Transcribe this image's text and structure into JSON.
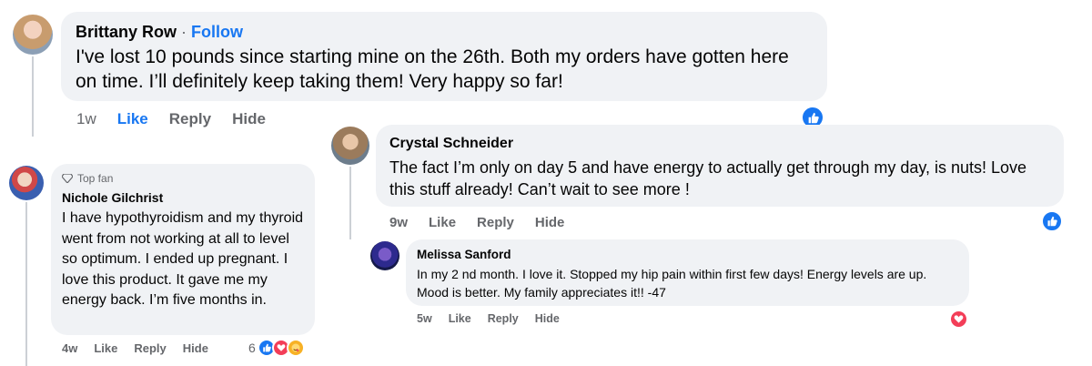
{
  "comments": {
    "brittany": {
      "name": "Brittany Row",
      "separator": "·",
      "follow_label": "Follow",
      "text": "I've lost 10 pounds since starting mine on the 26th. Both my orders have gotten here on time. I’ll definitely keep taking them! Very happy so far!",
      "time": "1w",
      "like": "Like",
      "reply": "Reply",
      "hide": "Hide",
      "reaction_icon": "like-icon"
    },
    "crystal": {
      "name": "Crystal Schneider",
      "text": "The fact I’m only on day 5 and have energy to actually get through my day, is nuts! Love this stuff already! Can’t wait to see more !",
      "time": "9w",
      "like": "Like",
      "reply": "Reply",
      "hide": "Hide",
      "reaction_icon": "like-icon"
    },
    "nichole": {
      "badge": "Top fan",
      "name": "Nichole Gilchrist",
      "text": "I have hypothyroidism and my thyroid went from not working at all to level so optimum. I ended up pregnant. I love this product. It gave me my energy back. I’m five months in.",
      "time": "4w",
      "like": "Like",
      "reply": "Reply",
      "hide": "Hide",
      "reaction_count": "6",
      "reaction_icons": [
        "like-icon",
        "love-icon",
        "care-icon"
      ]
    },
    "melissa": {
      "name": "Melissa Sanford",
      "text": "In my 2 nd month. I love it. Stopped my hip pain within first few days! Energy levels are up. Mood is better. My family appreciates it!! -47",
      "time": "5w",
      "like": "Like",
      "reply": "Reply",
      "hide": "Hide",
      "reaction_icon": "love-icon"
    }
  },
  "colors": {
    "bubble": "#f0f2f5",
    "link_blue": "#1877f2",
    "meta_gray": "#65676b",
    "love_red": "#f33e58"
  }
}
